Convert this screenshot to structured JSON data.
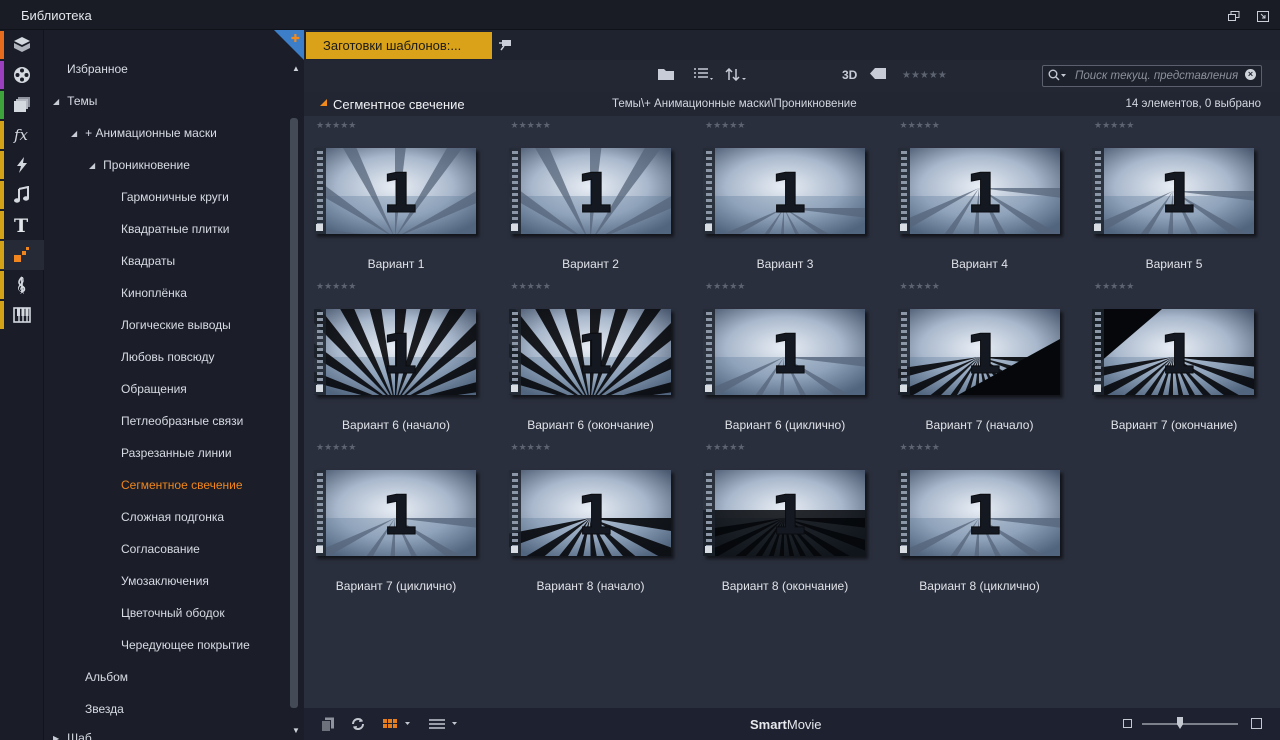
{
  "window": {
    "title": "Библиотека"
  },
  "iconstrip": {
    "items": [
      {
        "icon": "box-icon",
        "color": "#e66b1d"
      },
      {
        "icon": "film-reel-icon",
        "color": "#9b3fbf"
      },
      {
        "icon": "photos-icon",
        "color": "#3da33a"
      },
      {
        "icon": "fx-icon",
        "color": "#d4a217"
      },
      {
        "icon": "lightning-icon",
        "color": "#d4a217"
      },
      {
        "icon": "music-note-icon",
        "color": "#d4a217"
      },
      {
        "icon": "text-icon",
        "color": "#d4a217"
      },
      {
        "icon": "montage-icon",
        "color": "#d4a217"
      },
      {
        "icon": "treble-clef-icon",
        "color": "#d4a217"
      },
      {
        "icon": "piano-icon",
        "color": "#d4a217"
      }
    ]
  },
  "tree": {
    "favorites": "Избранное",
    "themes": "Темы",
    "anim_masks": "+ Анимационные маски",
    "penetration": "Проникновение",
    "children": [
      "Гармоничные круги",
      "Квадратные плитки",
      "Квадраты",
      "Киноплёнка",
      "Логические выводы",
      "Любовь повсюду",
      "Обращения",
      "Петлеобразные связи",
      "Разрезанные линии",
      "Сегментное свечение",
      "Сложная подгонка",
      "Согласование",
      "Умозаключения",
      "Цветочный ободок",
      "Чередующее покрытие"
    ],
    "selected_child": "Сегментное свечение",
    "album": "Альбом",
    "star": "Звезда",
    "clipped": "Шаб..."
  },
  "tab": {
    "label": "Заготовки шаблонов:..."
  },
  "toolbar": {
    "mode_3d": "3D",
    "search_placeholder": "Поиск текущ. представления",
    "rating": "★★★★★"
  },
  "pathbar": {
    "section": "Сегментное свечение",
    "path": "Темы\\+ Анимационные маски\\Проникновение",
    "count": "14 элементов, 0 выбрано"
  },
  "grid": {
    "items": [
      {
        "caption": "Вариант 1",
        "stars": "★★★★★"
      },
      {
        "caption": "Вариант 2",
        "stars": "★★★★★"
      },
      {
        "caption": "Вариант 3",
        "stars": "★★★★★"
      },
      {
        "caption": "Вариант 4",
        "stars": "★★★★★"
      },
      {
        "caption": "Вариант 5",
        "stars": "★★★★★"
      },
      {
        "caption": "Вариант 6 (начало)",
        "stars": "★★★★★"
      },
      {
        "caption": "Вариант 6 (окончание)",
        "stars": "★★★★★"
      },
      {
        "caption": "Вариант 6 (циклично)",
        "stars": "★★★★★"
      },
      {
        "caption": "Вариант 7 (начало)",
        "stars": "★★★★★"
      },
      {
        "caption": "Вариант 7 (окончание)",
        "stars": "★★★★★"
      },
      {
        "caption": "Вариант 7 (циклично)",
        "stars": "★★★★★"
      },
      {
        "caption": "Вариант 8 (начало)",
        "stars": "★★★★★"
      },
      {
        "caption": "Вариант 8 (окончание)",
        "stars": "★★★★★"
      },
      {
        "caption": "Вариант 8 (циклично)",
        "stars": "★★★★★"
      }
    ],
    "thumb_digit": "1"
  },
  "bottombar": {
    "brand_bold": "Smart",
    "brand_rest": "Movie"
  }
}
